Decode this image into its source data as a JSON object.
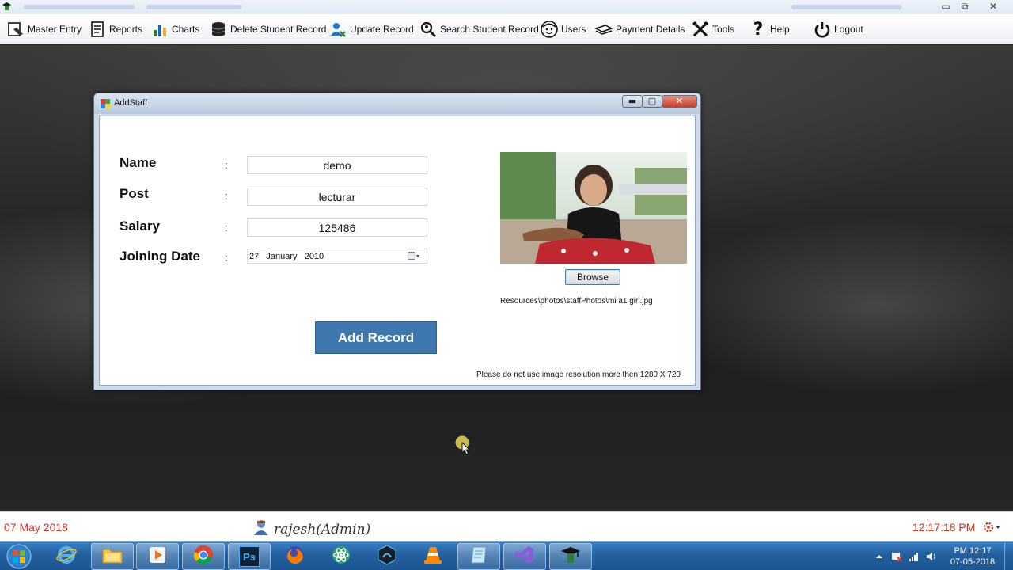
{
  "app": {
    "window_controls": {
      "minimize": "▭",
      "restore": "⧉",
      "close": "✕"
    }
  },
  "menu": {
    "items": [
      {
        "label": "Master Entry",
        "icon": "master-entry-icon"
      },
      {
        "label": "Reports",
        "icon": "reports-icon"
      },
      {
        "label": "Charts",
        "icon": "charts-icon"
      },
      {
        "label": "Delete Student Record",
        "icon": "delete-record-icon"
      },
      {
        "label": "Update Record",
        "icon": "update-record-icon"
      },
      {
        "label": "Search Student Record",
        "icon": "search-record-icon"
      },
      {
        "label": "Users",
        "icon": "users-icon"
      },
      {
        "label": "Payment Details",
        "icon": "payment-icon"
      },
      {
        "label": "Tools",
        "icon": "tools-icon"
      },
      {
        "label": "Help",
        "icon": "help-icon"
      },
      {
        "label": "Logout",
        "icon": "power-icon"
      }
    ]
  },
  "dialog": {
    "title": "AddStaff",
    "controls": {
      "minimize": "▬",
      "maximize": "▢",
      "close": "✕"
    },
    "fields": {
      "name_label": "Name",
      "name_value": "demo",
      "post_label": "Post",
      "post_value": "lecturar",
      "salary_label": "Salary",
      "salary_value": "125486",
      "joining_label": "Joining Date",
      "joining_value": "27   January   2010",
      "colon": ":"
    },
    "add_button": "Add Record",
    "browse_button": "Browse",
    "photo_path": "Resources\\photos\\staffPhotos\\mi a1 girl.jpg",
    "resolution_note": "Please do not use image resolution more then 1280 X 720"
  },
  "status": {
    "date": "07 May 2018",
    "user": "rajesh(Admin)",
    "time": "12:17:18 PM"
  },
  "taskbar": {
    "apps": [
      {
        "icon": "internet-explorer-icon",
        "active": false
      },
      {
        "icon": "file-explorer-icon",
        "active": true
      },
      {
        "icon": "media-player-icon",
        "active": true
      },
      {
        "icon": "chrome-icon",
        "active": true
      },
      {
        "icon": "photoshop-icon",
        "active": true
      },
      {
        "icon": "firefox-icon",
        "active": false
      },
      {
        "icon": "atom-icon",
        "active": false
      },
      {
        "icon": "nox-icon",
        "active": false
      },
      {
        "icon": "vlc-icon",
        "active": false
      },
      {
        "icon": "notepad-icon",
        "active": true
      },
      {
        "icon": "visual-studio-icon",
        "active": true
      },
      {
        "icon": "student-app-icon",
        "active": true
      }
    ],
    "photoshop_label": "Ps",
    "clock_time": "PM 12:17",
    "clock_date": "07-05-2018"
  },
  "colors": {
    "accent_button": "#3f78ae",
    "status_text": "#c0392b",
    "taskbar": "#235f9f"
  }
}
